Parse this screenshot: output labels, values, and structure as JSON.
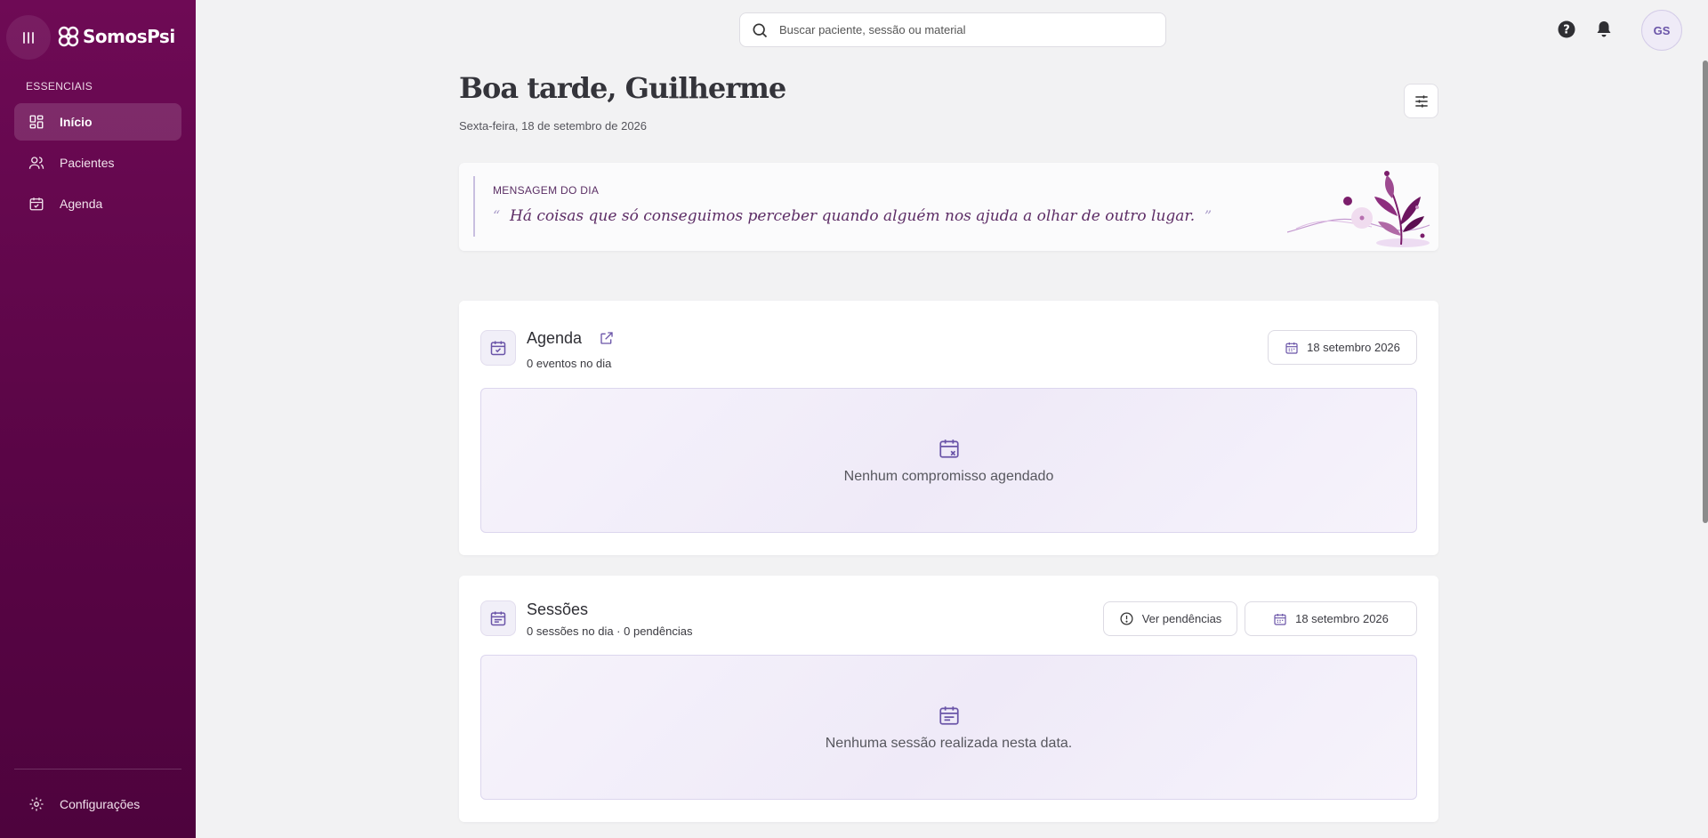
{
  "brand": {
    "name": "SomosPsi"
  },
  "sidebar": {
    "section_label": "ESSENCIAIS",
    "items": [
      {
        "label": "Início",
        "icon": "dashboard-icon",
        "active": true
      },
      {
        "label": "Pacientes",
        "icon": "users-icon",
        "active": false
      },
      {
        "label": "Agenda",
        "icon": "calendar-check-icon",
        "active": false
      }
    ],
    "settings_label": "Configurações"
  },
  "search": {
    "placeholder": "Buscar paciente, sessão ou material"
  },
  "user": {
    "initials": "GS"
  },
  "header": {
    "greeting": "Boa tarde, Guilherme",
    "date": "Sexta-feira, 18 de setembro de 2026"
  },
  "message": {
    "label": "MENSAGEM DO DIA",
    "open_quote": "“",
    "quote": "Há coisas que só conseguimos perceber quando alguém nos ajuda a olhar de outro lugar.",
    "close_quote": "”"
  },
  "agenda": {
    "title": "Agenda",
    "subtitle": "0 eventos no dia",
    "date_button": "18 setembro 2026",
    "empty_text": "Nenhum compromisso agendado"
  },
  "sessions": {
    "title": "Sessões",
    "subtitle": "0 sessões no dia · 0 pendências",
    "pending_button": "Ver pendências",
    "date_button": "18 setembro 2026",
    "empty_text": "Nenhuma sessão realizada nesta data."
  },
  "colors": {
    "sidebar": "#5e0649",
    "accent": "#6a54a8",
    "background": "#f2f2f3"
  }
}
